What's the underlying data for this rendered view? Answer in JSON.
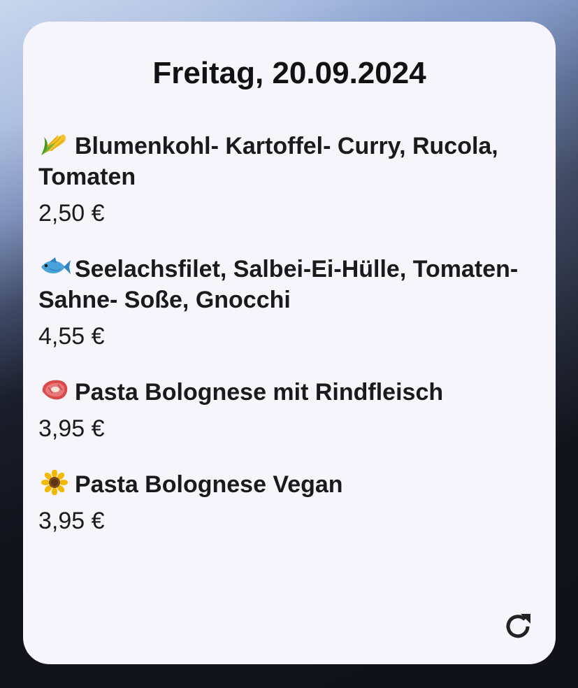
{
  "widget": {
    "date_title": "Freitag, 20.09.2024",
    "meals": [
      {
        "icon": "corn-icon",
        "name": "Blumenkohl- Kartoffel- Curry, Rucola, Tomaten",
        "price": "2,50 €"
      },
      {
        "icon": "fish-icon",
        "name": "Seelachsfilet, Salbei-Ei-Hülle, Tomaten- Sahne- Soße, Gnocchi",
        "price": "4,55 €"
      },
      {
        "icon": "steak-icon",
        "name": "Pasta Bolognese mit Rindfleisch",
        "price": "3,95 €"
      },
      {
        "icon": "sunflower-icon",
        "name": "Pasta Bolognese Vegan",
        "price": "3,95 €"
      }
    ],
    "refresh_icon": "refresh-icon"
  },
  "colors": {
    "card_background": "#f7f5fc",
    "text": "#111111"
  }
}
